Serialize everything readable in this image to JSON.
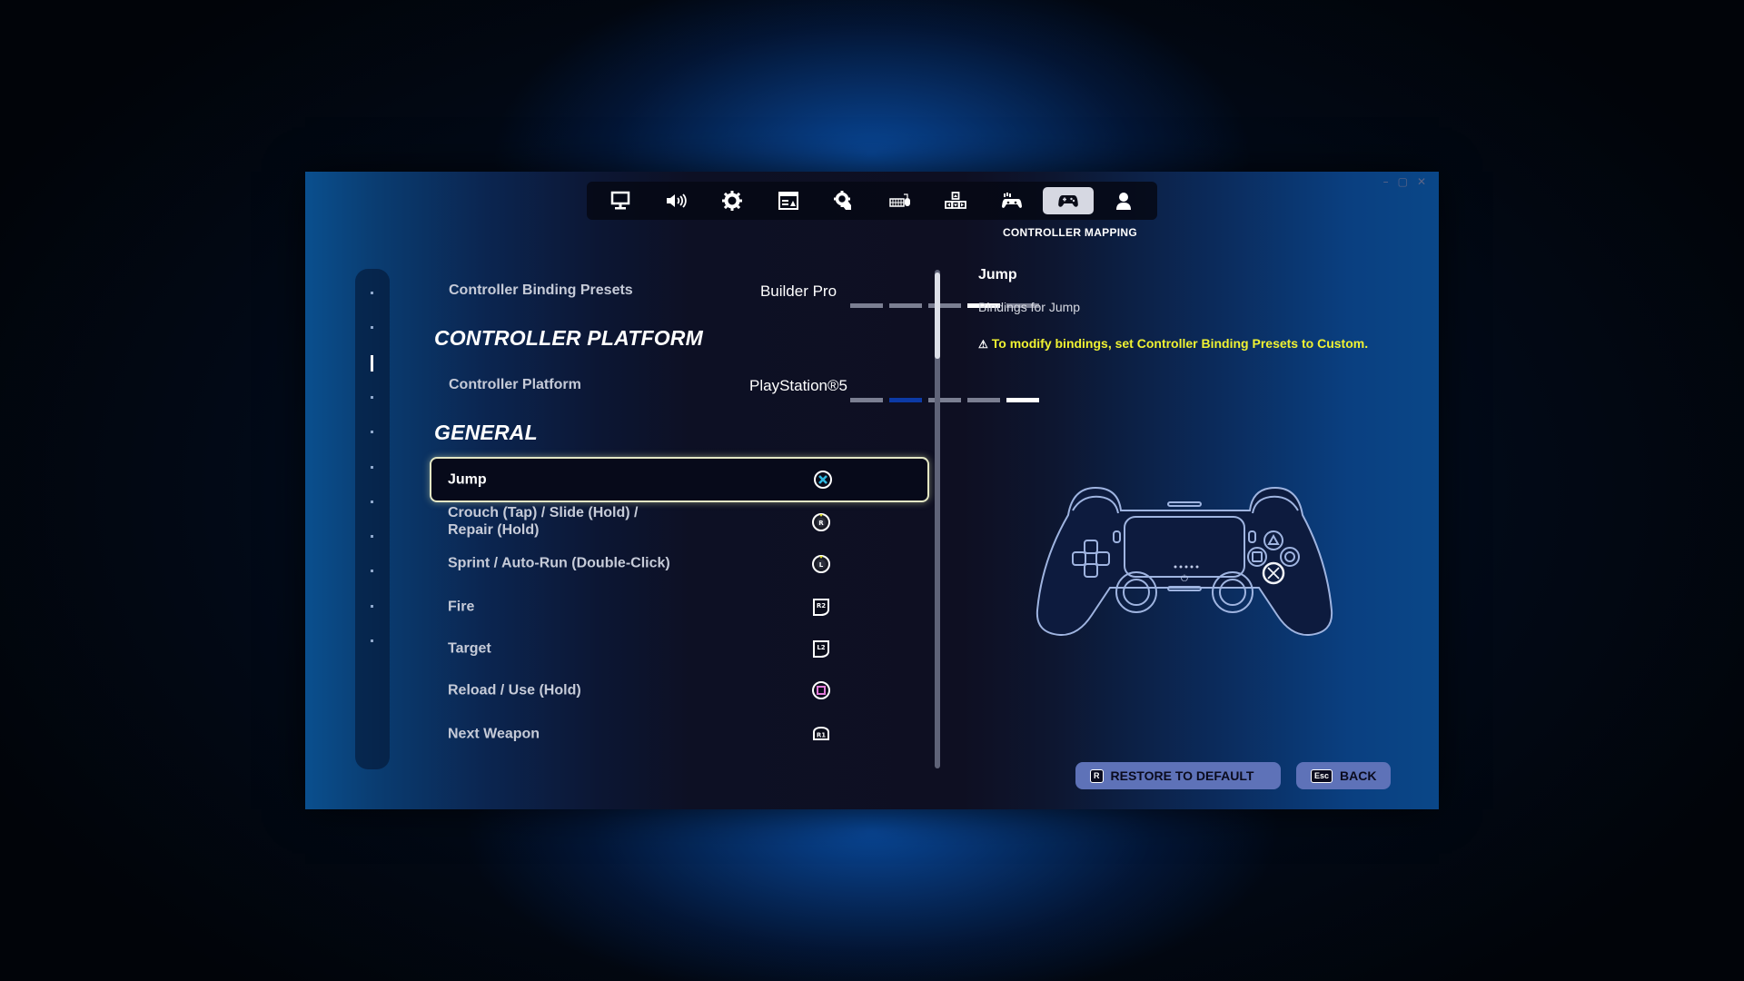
{
  "window_controls": {
    "minimize": "–",
    "maximize": "▢",
    "close": "✕"
  },
  "tabs": [
    {
      "icon": "monitor-icon",
      "label": "Display",
      "active": false
    },
    {
      "icon": "speaker-icon",
      "label": "Audio",
      "active": false
    },
    {
      "icon": "gear-icon",
      "label": "Game",
      "active": false
    },
    {
      "icon": "ui-window-icon",
      "label": "Game UI",
      "active": false
    },
    {
      "icon": "touch-gear-icon",
      "label": "Touch Settings",
      "active": false
    },
    {
      "icon": "keyboard-mouse-icon",
      "label": "Keyboard Controls",
      "active": false
    },
    {
      "icon": "arrow-keys-icon",
      "label": "Directional Controls",
      "active": false
    },
    {
      "icon": "controller-gear-icon",
      "label": "Controller",
      "active": false
    },
    {
      "icon": "controller-icon",
      "label": "Controller Mapping",
      "active": true
    },
    {
      "icon": "account-icon",
      "label": "Account",
      "active": false
    }
  ],
  "active_tab_caption": "CONTROLLER MAPPING",
  "sidebar": {
    "marker_count": 11,
    "active_index": 2
  },
  "settings": {
    "binding_presets": {
      "label": "Controller Binding Presets",
      "value": "Builder Pro",
      "option_count": 5,
      "selected_index": 3
    },
    "platform_header": "CONTROLLER PLATFORM",
    "platform": {
      "label": "Controller Platform",
      "value": "PlayStation®5",
      "option_count": 5,
      "selected_index": 4,
      "highlight_index": 1
    },
    "general_header": "GENERAL"
  },
  "bindings": [
    {
      "label": "Jump",
      "button": "Cross",
      "icon": "ps-cross-icon",
      "selected": true
    },
    {
      "label": "Crouch (Tap) / Slide (Hold) / Repair (Hold)",
      "button": "R3",
      "icon": "right-stick-click-icon",
      "selected": false
    },
    {
      "label": "Sprint / Auto-Run (Double-Click)",
      "button": "L3",
      "icon": "left-stick-click-icon",
      "selected": false
    },
    {
      "label": "Fire",
      "button": "R2",
      "icon": "r2-trigger-icon",
      "selected": false
    },
    {
      "label": "Target",
      "button": "L2",
      "icon": "l2-trigger-icon",
      "selected": false
    },
    {
      "label": "Reload / Use (Hold)",
      "button": "Square",
      "icon": "ps-square-icon",
      "selected": false
    },
    {
      "label": "Next Weapon",
      "button": "R1",
      "icon": "r1-bumper-icon",
      "selected": false
    }
  ],
  "scroll": {
    "position_fraction": 0.0,
    "visible_fraction": 0.17
  },
  "detail": {
    "title": "Jump",
    "description": "Bindings for Jump",
    "warning": "To modify bindings, set Controller Binding Presets to Custom.",
    "highlighted_button": "Cross"
  },
  "buttons": {
    "restore": {
      "key": "R",
      "label": "RESTORE TO DEFAULT"
    },
    "back": {
      "key": "Esc",
      "label": "BACK"
    }
  },
  "colors": {
    "warning": "#f0f232",
    "selected_border": "#e4e7c5",
    "button_bg": "#5e72b8",
    "segment_active": "#ffffff",
    "segment_inactive": "#7b7f92",
    "segment_highlight": "#0c3aa6",
    "cross_button": "#2fb8e0",
    "square_button": "#e07ad8"
  }
}
